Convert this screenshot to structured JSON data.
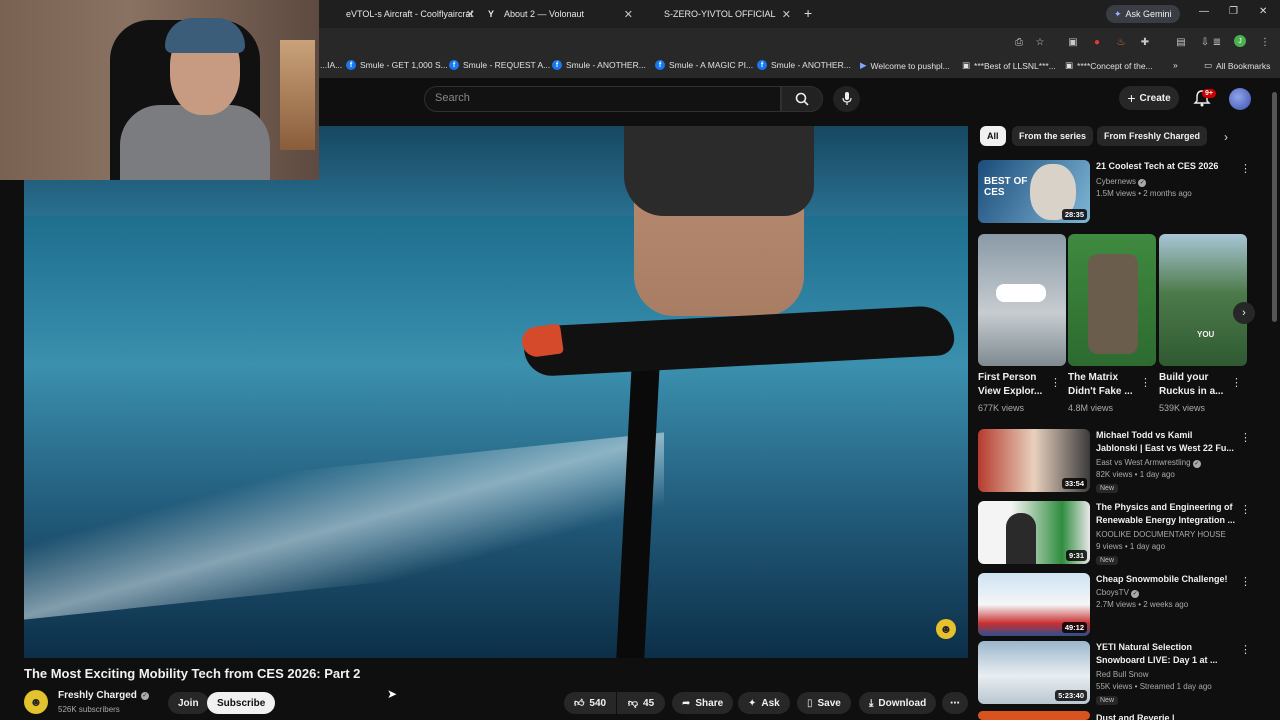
{
  "browser": {
    "tabs": [
      {
        "label": "eVTOL-s Aircraft - Coolflyaircraf"
      },
      {
        "label": "About 2 — Volonaut"
      },
      {
        "label": "S-ZERO-YIVTOL OFFICIAL"
      }
    ],
    "gemini_label": "Ask Gemini",
    "bookmarks": [
      {
        "label": "...IA...",
        "icon": "page-icon"
      },
      {
        "label": "Smule - GET 1,000 S...",
        "icon": "facebook-icon"
      },
      {
        "label": "Smule - REQUEST A...",
        "icon": "facebook-icon"
      },
      {
        "label": "Smule - ANOTHER...",
        "icon": "facebook-icon"
      },
      {
        "label": "Smule - A MAGIC PI...",
        "icon": "facebook-icon"
      },
      {
        "label": "Smule - ANOTHER...",
        "icon": "facebook-icon"
      },
      {
        "label": "Welcome to pushpl...",
        "icon": "play-icon"
      },
      {
        "label": "***Best of LLSNL***...",
        "icon": "page-icon"
      },
      {
        "label": "****Concept of the...",
        "icon": "page-icon"
      }
    ],
    "all_bookmarks": "All Bookmarks"
  },
  "youtube": {
    "search_placeholder": "Search",
    "create_label": "Create",
    "notifications_badge": "9+"
  },
  "video": {
    "title": "The Most Exciting Mobility Tech from CES 2026: Part 2",
    "channel": "Freshly Charged",
    "subscribers": "526K subscribers",
    "join": "Join",
    "subscribe": "Subscribe",
    "likes": "540",
    "dislikes": "45",
    "share": "Share",
    "ask": "Ask",
    "save": "Save",
    "download": "Download"
  },
  "sidebar": {
    "chips": [
      "All",
      "From the series",
      "From Freshly Charged"
    ],
    "top_card": {
      "title": "21 Coolest Tech at CES 2026",
      "channel": "Cybernews",
      "meta": "1.5M views • 2 months ago",
      "duration": "28:35",
      "thumb_text": "BEST OF CES"
    },
    "shorts": [
      {
        "title": "First Person View Explor...",
        "views": "677K views"
      },
      {
        "title": "The Matrix Didn't Fake ...",
        "views": "4.8M views"
      },
      {
        "title": "Build your Ruckus in a...",
        "views": "539K views"
      }
    ],
    "cards": [
      {
        "title": "Michael Todd vs Kamil Jablonski | East vs West 22 Fu...",
        "channel": "East vs West Armwrestling",
        "meta": "82K views • 1 day ago",
        "new": "New",
        "duration": "33:54"
      },
      {
        "title": "The Physics and Engineering of Renewable Energy Integration ...",
        "channel": "KOOLIKE DOCUMENTARY HOUSE",
        "meta": "9 views • 1 day ago",
        "new": "New",
        "duration": "9:31"
      },
      {
        "title": "Cheap Snowmobile Challenge!",
        "channel": "CboysTV",
        "meta": "2.7M views • 2 weeks ago",
        "new": "",
        "duration": "49:12"
      },
      {
        "title": "YETI Natural Selection Snowboard LIVE: Day 1 at ...",
        "channel": "Red Bull Snow",
        "meta": "55K views • Streamed 1 day ago",
        "new": "New",
        "duration": "5:23:40"
      },
      {
        "title": "Dust and Reverie | Psychedelic...",
        "channel": "",
        "meta": "",
        "new": "",
        "duration": ""
      }
    ]
  }
}
